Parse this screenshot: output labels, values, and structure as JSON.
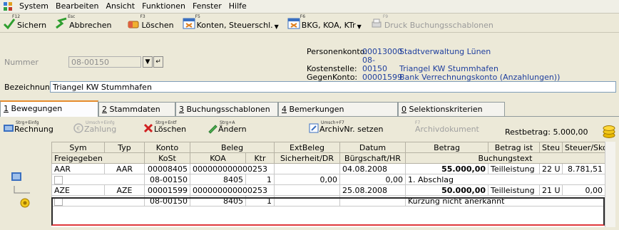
{
  "menu": {
    "items": [
      "System",
      "Bearbeiten",
      "Ansicht",
      "Funktionen",
      "Fenster",
      "Hilfe"
    ]
  },
  "toolbar": {
    "save": {
      "shortcut": "F12",
      "label": "Sichern"
    },
    "cancel": {
      "shortcut": "Esc",
      "label": "Abbrechen"
    },
    "delete": {
      "shortcut": "F3",
      "label": "Löschen"
    },
    "accounts": {
      "shortcut": "F5",
      "label": "Konten, Steuerschl."
    },
    "bkg": {
      "shortcut": "F6",
      "label": "BKG, KOA, KTr"
    },
    "print": {
      "shortcut": "F9",
      "label": "Druck Buchungsschablonen"
    }
  },
  "header": {
    "nummer_label": "Nummer",
    "nummer_value": "08-00150",
    "bezeichnung_label": "Bezeichnung",
    "bezeichnung_value": "Triangel KW Stummhafen",
    "info": [
      {
        "key": "Personenkonto:",
        "num": "00013000",
        "text": "Stadtverwaltung Lünen"
      },
      {
        "key": "Kostenstelle:",
        "num": "08-00150",
        "text": "Triangel KW Stummhafen"
      },
      {
        "key": "GegenKonto:",
        "num": "00001599",
        "text": "Bank Verrechnungskonto (Anzahlungen))"
      }
    ]
  },
  "tabs": [
    {
      "key": "1",
      "label": " Bewegungen"
    },
    {
      "key": "2",
      "label": " Stammdaten"
    },
    {
      "key": "3",
      "label": " Buchungsschablonen"
    },
    {
      "key": "4",
      "label": " Bemerkungen"
    },
    {
      "key": "0",
      "label": " Selektionskriterien"
    }
  ],
  "actions": {
    "rechnung": {
      "shortcut": "Strg+Einfg",
      "label": "Rechnung"
    },
    "zahlung": {
      "shortcut": "Umsch+Einfg",
      "label": "Zahlung"
    },
    "loeschen": {
      "shortcut": "Strg+Entf",
      "label": "Löschen"
    },
    "aendern": {
      "shortcut": "Strg+A",
      "label": "Ändern"
    },
    "archiv": {
      "shortcut": "Umsch+F7",
      "label": "ArchivNr. setzen"
    },
    "archivdok": {
      "shortcut": "F7",
      "label": "Archivdokument"
    },
    "restbetrag": "Restbetrag: 5.000,00"
  },
  "grid": {
    "header1": [
      "Sym",
      "Typ",
      "Konto",
      "Beleg",
      "ExtBeleg",
      "Datum",
      "Betrag",
      "Betrag ist",
      "Steu",
      "Steuer/Skontc"
    ],
    "header2": [
      "Freigegeben",
      "KoSt",
      "KOA",
      "Ktr",
      "Sicherheit/DR",
      "Bürgschaft/HR",
      "Buchungstext"
    ],
    "rows": [
      {
        "sym": "AAR",
        "typ": "AAR",
        "konto": "00008405",
        "beleg": "000000000000253",
        "extbeleg": "",
        "datum": "04.08.2008",
        "betrag": "55.000,00",
        "betrag_ist": "Teilleistung",
        "steu": "22 U",
        "steuer": "8.781,51",
        "kost": "08-00150",
        "koa": "8405",
        "ktr": "1",
        "sicherheit": "0,00",
        "buergschaft": "0,00",
        "buchungstext": "1. Abschlag"
      },
      {
        "sym": "AZE",
        "typ": "AZE",
        "konto": "00001599",
        "beleg": "000000000000253",
        "extbeleg": "",
        "datum": "25.08.2008",
        "betrag": "50.000,00",
        "betrag_ist": "Teilleistung",
        "steu": "21 U",
        "steuer": "0,00",
        "kost": "08-00150",
        "koa": "8405",
        "ktr": "1",
        "sicherheit": "",
        "buergschaft": "",
        "buchungstext": "Kürzung nicht anerkannt"
      }
    ]
  }
}
